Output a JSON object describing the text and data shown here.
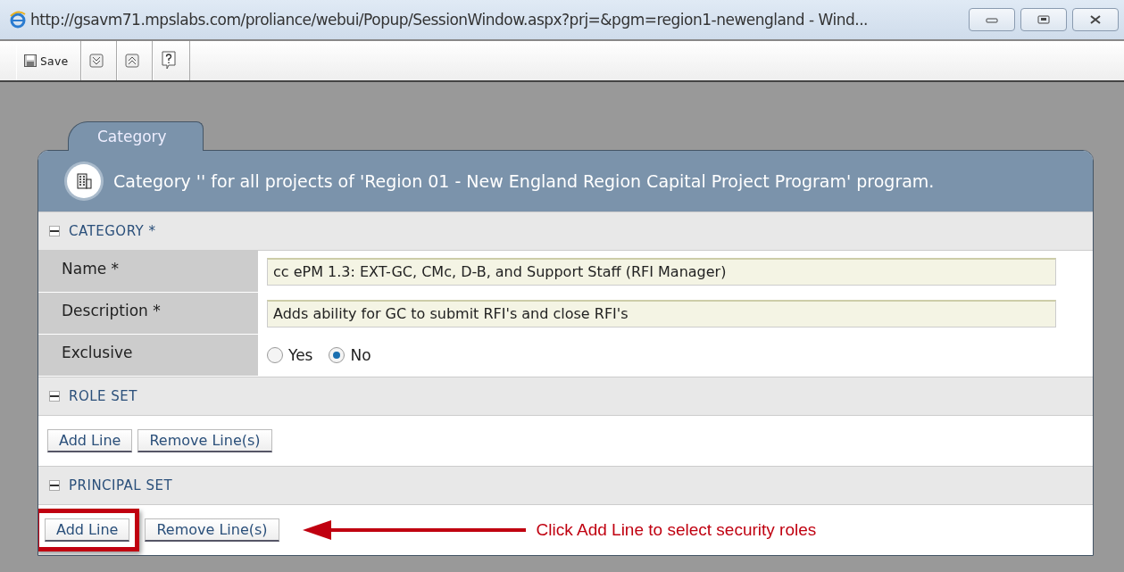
{
  "window": {
    "title": "http://gsavm71.mpslabs.com/proliance/webui/Popup/SessionWindow.aspx?prj=&pgm=region1-newengland - Wind..."
  },
  "toolbar": [
    {
      "kind": "save",
      "label": "Save"
    },
    {
      "kind": "down"
    },
    {
      "kind": "up"
    },
    {
      "kind": "help"
    }
  ],
  "tab": {
    "label": "Category"
  },
  "header": {
    "text": "Category '' for all projects of 'Region 01 - New England Region Capital Project Program' program."
  },
  "sections": [
    {
      "kind": "form",
      "title": "CATEGORY *",
      "fields": [
        {
          "kind": "text",
          "label": "Name *",
          "value": "cc ePM 1.3: EXT-GC, CMc, D-B, and Support Staff (RFI Manager)"
        },
        {
          "kind": "text",
          "label": "Description *",
          "value": "Adds ability for GC to submit RFI's and close RFI's"
        },
        {
          "kind": "radio",
          "label": "Exclusive",
          "options": [
            {
              "label": "Yes",
              "selected": false
            },
            {
              "label": "No",
              "selected": true
            }
          ]
        }
      ]
    },
    {
      "kind": "buttons",
      "title": "ROLE SET",
      "buttons": [
        "Add Line",
        "Remove Line(s)"
      ],
      "highlight": false
    },
    {
      "kind": "buttons",
      "title": "PRINCIPAL SET",
      "buttons": [
        "Add Line",
        "Remove Line(s)"
      ],
      "highlight": true
    }
  ],
  "annotation": {
    "text": "Click Add Line to select security roles"
  }
}
